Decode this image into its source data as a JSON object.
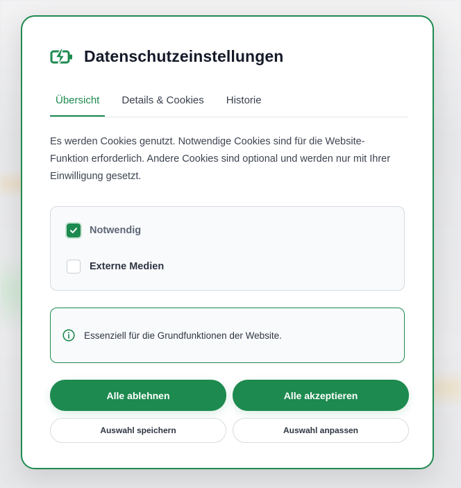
{
  "dialog": {
    "title": "Datenschutzeinstellungen",
    "logo_icon": "battery-charging-icon",
    "accent_color": "#1d8a4f"
  },
  "tabs": [
    {
      "label": "Übersicht",
      "active": true
    },
    {
      "label": "Details & Cookies",
      "active": false
    },
    {
      "label": "Historie",
      "active": false
    }
  ],
  "description": "Es werden Cookies genutzt. Notwendige Cookies sind für die Website-Funktion erforderlich. Andere Cookies sind optional und werden nur mit Ihrer Einwilligung gesetzt.",
  "options": [
    {
      "label": "Notwendig",
      "checked": true
    },
    {
      "label": "Externe Medien",
      "checked": false
    }
  ],
  "info": {
    "icon": "info-icon",
    "text": "Essenziell für die Grundfunktionen der Website."
  },
  "buttons": {
    "reject_all": "Alle ablehnen",
    "accept_all": "Alle akzeptieren",
    "save_selection": "Auswahl speichern",
    "customize_selection": "Auswahl anpassen"
  }
}
